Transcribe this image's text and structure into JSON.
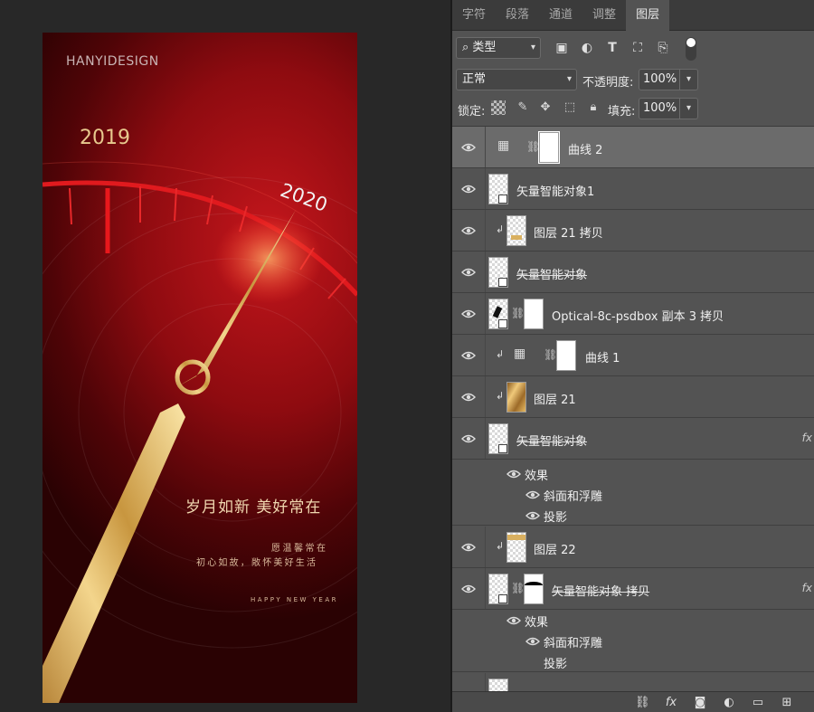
{
  "canvas": {
    "poster": {
      "brand": "HANYIDESIGN",
      "year_start": "2019",
      "year_end": "2020",
      "slogan": "岁月如新  美好常在",
      "subline_1": "愿温馨常在",
      "subline_2": "初心如故，敞怀美好生活",
      "footer": "HAPPY NEW YEAR",
      "colors": {
        "red_light": "#c4161c",
        "red_dark": "#2a0203",
        "gold": "#e7c98e"
      }
    }
  },
  "panel": {
    "tabs": [
      {
        "label": "字符"
      },
      {
        "label": "段落"
      },
      {
        "label": "通道"
      },
      {
        "label": "调整"
      },
      {
        "label": "图层"
      }
    ],
    "active_tab": "图层",
    "filter": {
      "label": "类型",
      "search_icon": "search-icon"
    },
    "blend_mode": "正常",
    "opacity_label": "不透明度:",
    "opacity_value": "100%",
    "lock_label": "锁定:",
    "fill_label": "填充:",
    "fill_value": "100%",
    "layers": [
      {
        "name": "曲线 2",
        "kind": "adjustment",
        "selected": true
      },
      {
        "name": "矢量智能对象1",
        "kind": "smart-object"
      },
      {
        "name": "图层 21 拷贝",
        "kind": "pixel",
        "clipped": true
      },
      {
        "name": "矢量智能对象",
        "kind": "smart-object",
        "strikethrough": true
      },
      {
        "name": "Optical-8c-psdbox 副本 3 拷贝",
        "kind": "smart-object-masked"
      },
      {
        "name": "曲线 1",
        "kind": "adjustment",
        "clipped": true
      },
      {
        "name": "图层 21",
        "kind": "pixel",
        "clipped": true
      },
      {
        "name": "矢量智能对象",
        "kind": "smart-object",
        "strikethrough": true,
        "effects": [
          "效果",
          "斜面和浮雕",
          "投影"
        ]
      },
      {
        "name": "图层 22",
        "kind": "pixel",
        "clipped": true
      },
      {
        "name": "矢量智能对象 拷贝",
        "kind": "smart-object-masked",
        "strikethrough": true,
        "effects": [
          "效果",
          "斜面和浮雕",
          "投影"
        ]
      }
    ],
    "bottom_icons": [
      "link-icon",
      "fx-icon",
      "mask-icon",
      "adjustment-icon",
      "folder-icon",
      "new-layer-icon"
    ]
  }
}
